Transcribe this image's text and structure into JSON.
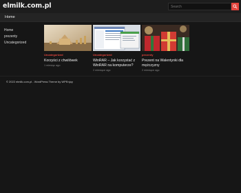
{
  "site": {
    "title": "elmilk.com.pl"
  },
  "search": {
    "placeholder": "Search"
  },
  "nav": {
    "home": "Home"
  },
  "sidebar": {
    "items": [
      "Home",
      "prezenty",
      "Uncategorized"
    ]
  },
  "posts": [
    {
      "category": "Uncategorized",
      "title": "Korzyści z chwilówek",
      "date": "1 miesiąc ago"
    },
    {
      "category": "Uncategorized",
      "title": "WinRAR – Jak korzystać z WinRAR na komputerze?",
      "date": "2 miesiące ago"
    },
    {
      "category": "prezenty",
      "title": "Prezent na Walentynki dla mężczyzny",
      "date": "2 miesiące ago"
    }
  ],
  "footer": {
    "text": "© 2022 elmilk.com.pl - WordPress Theme by WPEnjoy"
  },
  "colors": {
    "accent": "#e2453d",
    "background": "#161616",
    "header": "#1d1d1d"
  }
}
